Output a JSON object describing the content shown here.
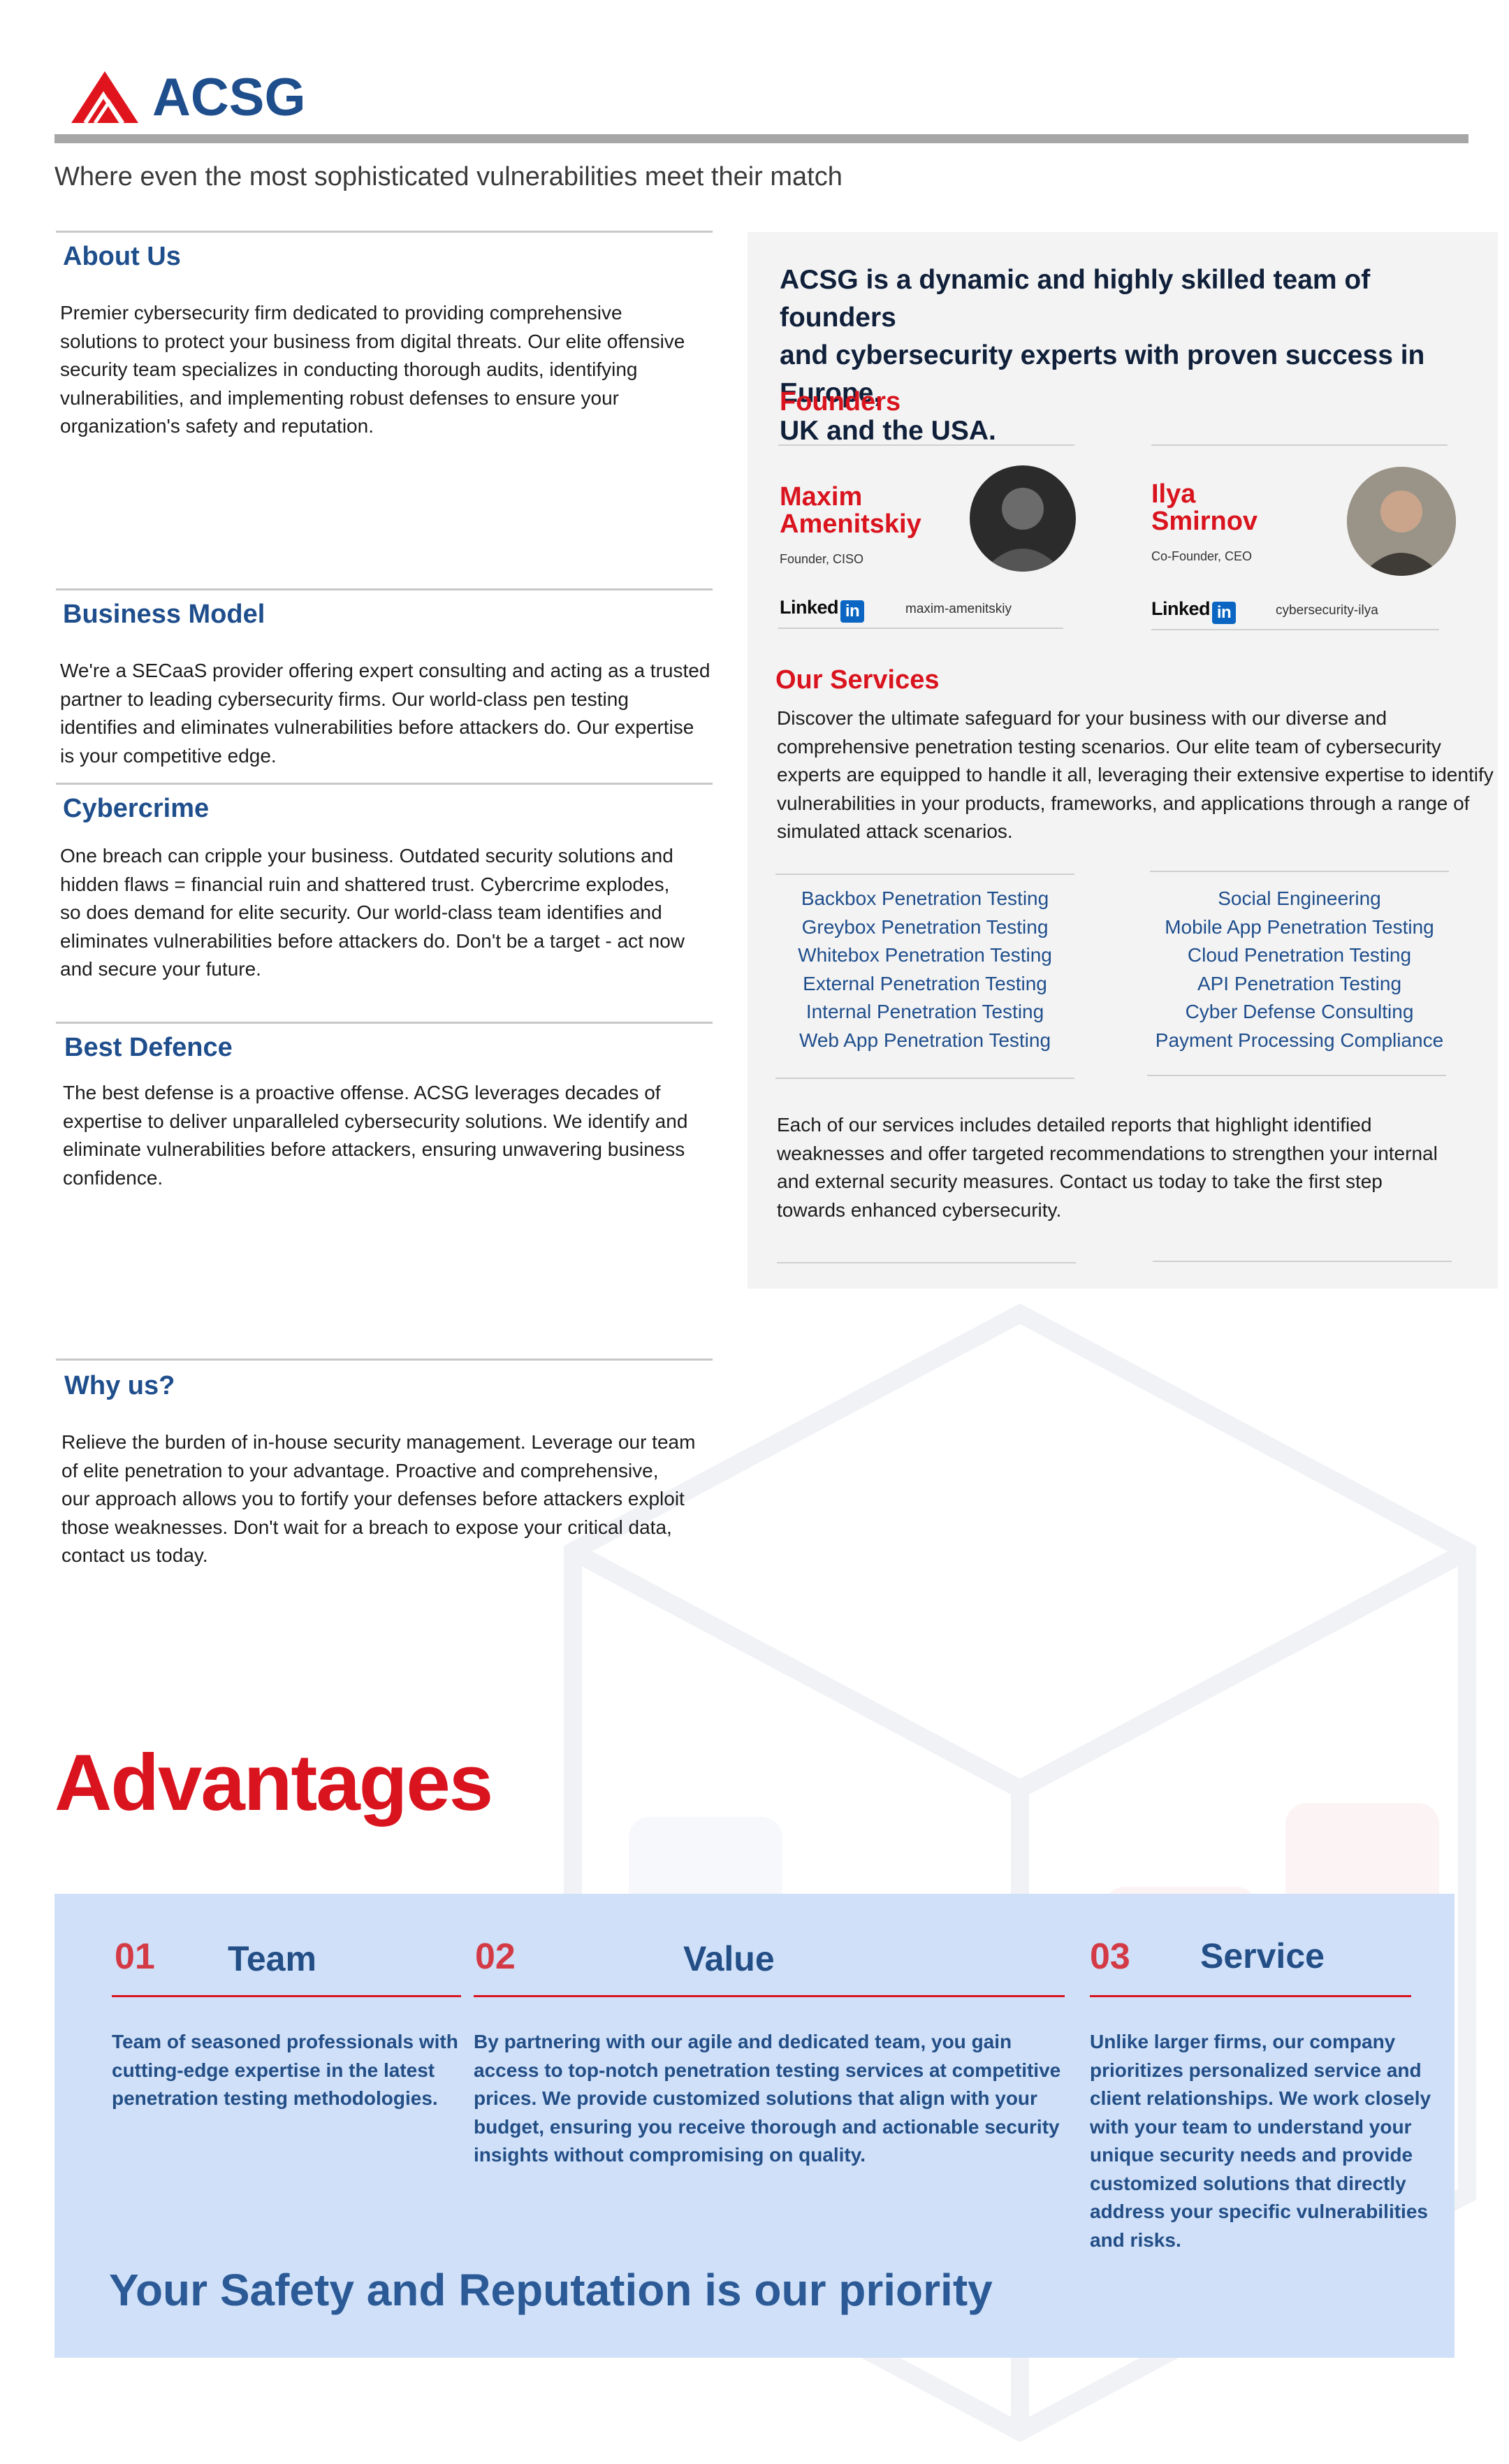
{
  "brand": {
    "name": "ACSG",
    "tagline": "Where even the most sophisticated vulnerabilities meet their match",
    "colors": {
      "red": "#d9141e",
      "navy": "#1f4e8c",
      "panel": "#f3f3f3",
      "band": "#cfe0f8"
    }
  },
  "sections": {
    "about": {
      "title": "About Us",
      "lines": [
        "Premier cybersecurity firm dedicated to providing comprehensive",
        "solutions to protect your business from digital threats. Our elite offensive",
        "security team specializes in conducting thorough audits, identifying",
        "vulnerabilities, and implementing robust defenses to ensure your",
        "organization's safety and reputation."
      ]
    },
    "business_model": {
      "title": "Business Model",
      "lines": [
        "We're a SECaaS provider offering expert consulting and acting as a trusted",
        "partner to leading cybersecurity firms. Our world-class pen testing",
        "identifies and eliminates vulnerabilities before attackers do. Our expertise",
        "is your competitive edge."
      ]
    },
    "cybercrime": {
      "title": "Cybercrime",
      "lines": [
        "One breach can cripple your business. Outdated security solutions and",
        "hidden flaws = financial ruin and  shattered trust. Cybercrime explodes,",
        "so does demand for elite security. Our world-class team identifies and",
        "eliminates vulnerabilities before attackers do. Don't be a target - act now",
        "and secure your future."
      ]
    },
    "best_defence": {
      "title": "Best Defence",
      "lines": [
        "The best defense is a proactive offense. ACSG leverages decades of",
        "expertise to deliver unparalleled cybersecurity solutions. We identify and",
        "eliminate vulnerabilities before attackers, ensuring unwavering business",
        "confidence."
      ]
    },
    "why_us": {
      "title": "Why us?",
      "lines": [
        "Relieve the burden of in-house security management. Leverage our team",
        "of elite penetration to your advantage. Proactive and comprehensive,",
        "our approach allows you to fortify your defenses before attackers exploit",
        "those weaknesses. Don't wait for a breach to expose your critical data,",
        "contact us today."
      ]
    }
  },
  "panel": {
    "intro_lines": [
      "ACSG is a dynamic and highly skilled team of founders",
      "and cybersecurity experts with proven success in Europe,",
      "UK and the USA."
    ],
    "founders_title": "Founders",
    "founders": [
      {
        "first": "Maxim",
        "last": "Amenitskiy",
        "role": "Founder, CISO",
        "linkedin_word": "Linked",
        "linkedin_in": "in",
        "handle": "maxim-amenitskiy"
      },
      {
        "first": "Ilya",
        "last": "Smirnov",
        "role": "Co-Founder, CEO",
        "linkedin_word": "Linked",
        "linkedin_in": "in",
        "handle": "cybersecurity-ilya"
      }
    ],
    "services_title": "Our Services",
    "services_intro": [
      "Discover the ultimate safeguard for your business with our diverse and",
      "comprehensive penetration testing scenarios. Our elite team of cybersecurity",
      "experts are equipped to handle it all, leveraging their extensive expertise to identify",
      "vulnerabilities in your products, frameworks, and applications through a range of",
      "simulated attack scenarios."
    ],
    "services_left": [
      "Backbox Penetration Testing",
      "Greybox Penetration Testing",
      "Whitebox Penetration Testing",
      "External Penetration Testing",
      "Internal Penetration Testing",
      "Web App Penetration Testing"
    ],
    "services_right": [
      "Social Engineering",
      "Mobile App Penetration Testing",
      "Cloud Penetration Testing",
      "API Penetration Testing",
      "Cyber Defense Consulting",
      "Payment Processing Compliance"
    ],
    "services_outro": [
      "Each of our services includes detailed reports that highlight identified",
      "weaknesses and offer targeted recommendations to strengthen your internal",
      "and external security measures. Contact us today to take the first step",
      "towards enhanced cybersecurity."
    ]
  },
  "advantages": {
    "title": "Advantages",
    "items": [
      {
        "num": "01",
        "label": "Team",
        "lines": [
          "Team of seasoned professionals with",
          "cutting-edge expertise in the latest",
          "penetration testing methodologies."
        ]
      },
      {
        "num": "02",
        "label": "Value",
        "lines": [
          "By partnering with our agile and dedicated team, you gain",
          "access to top-notch penetration testing services at competitive",
          "prices. We provide customized solutions that align with your",
          "budget, ensuring you receive thorough and actionable security",
          "insights without compromising on quality."
        ]
      },
      {
        "num": "03",
        "label": "Service",
        "lines": [
          "Unlike larger firms, our company",
          "prioritizes personalized service and",
          "client relationships. We work closely",
          "with your team to understand your",
          "unique security needs and provide",
          "customized solutions that directly",
          "address your specific vulnerabilities",
          "and risks."
        ]
      }
    ],
    "slogan": "Your Safety and Reputation is our priority"
  }
}
